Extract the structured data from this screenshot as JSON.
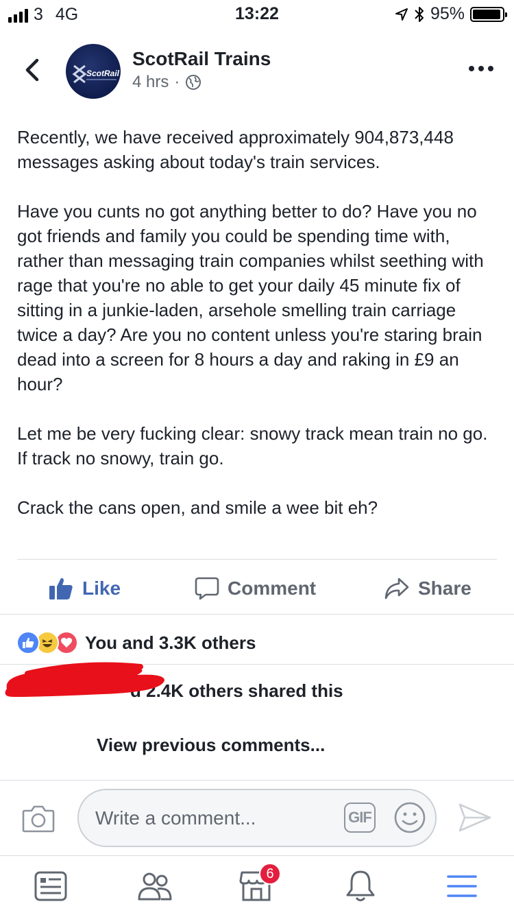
{
  "status_bar": {
    "carrier": "3",
    "network": "4G",
    "time": "13:22",
    "battery": "95%",
    "battery_level": 0.95
  },
  "post": {
    "page_name": "ScotRail Trains",
    "avatar_text": "ScotRail",
    "time_ago": "4 hrs",
    "separator": "·",
    "paragraphs": [
      "Recently, we have received approximately 904,873,448 messages asking about today's train services.",
      "Have you cunts no got anything better to do? Have you no got friends and family you could be spending time with, rather than messaging train companies whilst seething with rage that you're no able to get your daily 45 minute fix of sitting in a junkie-laden, arsehole smelling train carriage twice a day? Are you no content unless you're staring brain dead into a screen for 8 hours a day and raking in £9 an hour?",
      "Let me be very fucking clear: snowy track mean train no go. If track no snowy, train go.",
      "Crack the cans open, and smile a wee bit eh?"
    ]
  },
  "actions": {
    "like": "Like",
    "comment": "Comment",
    "share": "Share"
  },
  "engagement": {
    "reactions_text": "You and 3.3K others",
    "shares_text": "d 2.4K others shared this",
    "view_previous": "View previous comments..."
  },
  "composer": {
    "placeholder": "Write a comment...",
    "gif_label": "GIF"
  },
  "tab_bar": {
    "marketplace_badge": "6"
  },
  "colors": {
    "fb_blue": "#4267b2",
    "gray_text": "#606770",
    "badge_red": "#e41e3f",
    "tab_active": "#4f85f6"
  },
  "icons": [
    "back-arrow-icon",
    "globe-icon",
    "more-icon",
    "like-icon",
    "comment-icon",
    "share-icon",
    "camera-icon",
    "emoji-icon",
    "send-icon",
    "news-feed-icon",
    "friends-icon",
    "marketplace-icon",
    "notifications-icon",
    "menu-icon"
  ]
}
